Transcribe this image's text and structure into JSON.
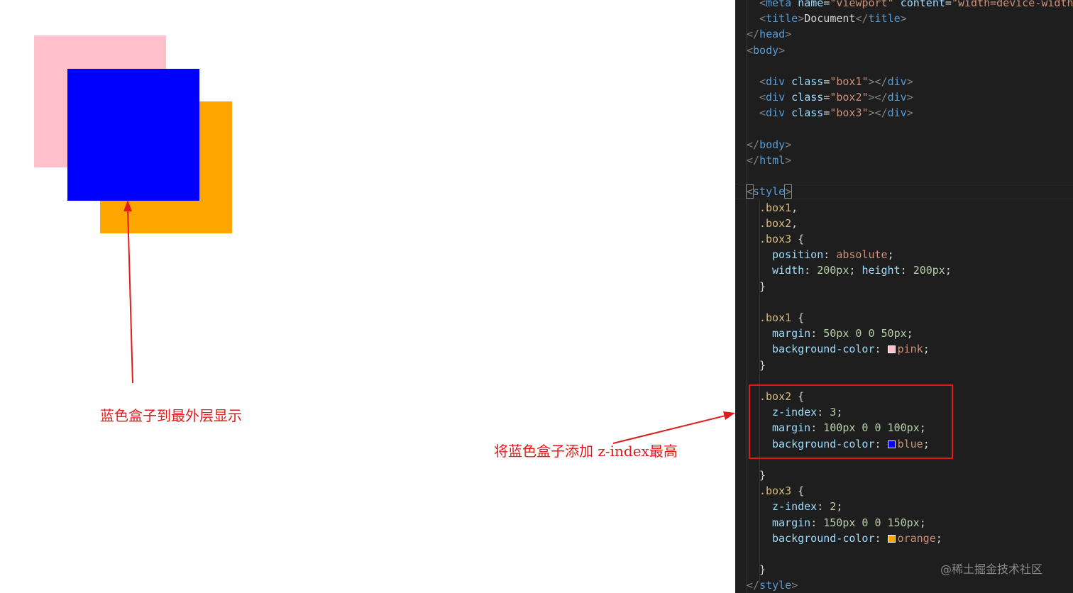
{
  "preview": {
    "boxes": [
      {
        "name": "box1",
        "color": "#ffc0cb"
      },
      {
        "name": "box2",
        "color": "#0000ff"
      },
      {
        "name": "box3",
        "color": "#ffa500"
      }
    ]
  },
  "annotations": {
    "left_note": "蓝色盒子到最外层显示",
    "mid_note": "将蓝色盒子添加  z-index最高",
    "color": "#e31a1a"
  },
  "editor": {
    "lines": [
      [
        [
          "tok-punc",
          "<"
        ],
        [
          "tok-tag",
          "meta"
        ],
        [
          "tok-text",
          " "
        ],
        [
          "tok-attr",
          "name"
        ],
        [
          "tok-text",
          "="
        ],
        [
          "tok-str",
          "\"viewport\""
        ],
        [
          "tok-text",
          " "
        ],
        [
          "tok-attr",
          "content"
        ],
        [
          "tok-text",
          "="
        ],
        [
          "tok-str",
          "\"width=device-width"
        ]
      ],
      [
        [
          "tok-punc",
          "<"
        ],
        [
          "tok-tag",
          "title"
        ],
        [
          "tok-punc",
          ">"
        ],
        [
          "tok-text",
          "Document"
        ],
        [
          "tok-punc",
          "</"
        ],
        [
          "tok-tag",
          "title"
        ],
        [
          "tok-punc",
          ">"
        ]
      ],
      [
        [
          "tok-punc",
          "</"
        ],
        [
          "tok-tag",
          "head"
        ],
        [
          "tok-punc",
          ">"
        ]
      ],
      [
        [
          "tok-punc",
          "<"
        ],
        [
          "tok-tag",
          "body"
        ],
        [
          "tok-punc",
          ">"
        ]
      ],
      [],
      [
        [
          "tok-punc",
          "<"
        ],
        [
          "tok-tag",
          "div"
        ],
        [
          "tok-text",
          " "
        ],
        [
          "tok-attr",
          "class"
        ],
        [
          "tok-text",
          "="
        ],
        [
          "tok-str",
          "\"box1\""
        ],
        [
          "tok-punc",
          "></"
        ],
        [
          "tok-tag",
          "div"
        ],
        [
          "tok-punc",
          ">"
        ]
      ],
      [
        [
          "tok-punc",
          "<"
        ],
        [
          "tok-tag",
          "div"
        ],
        [
          "tok-text",
          " "
        ],
        [
          "tok-attr",
          "class"
        ],
        [
          "tok-text",
          "="
        ],
        [
          "tok-str",
          "\"box2\""
        ],
        [
          "tok-punc",
          "></"
        ],
        [
          "tok-tag",
          "div"
        ],
        [
          "tok-punc",
          ">"
        ]
      ],
      [
        [
          "tok-punc",
          "<"
        ],
        [
          "tok-tag",
          "div"
        ],
        [
          "tok-text",
          " "
        ],
        [
          "tok-attr",
          "class"
        ],
        [
          "tok-text",
          "="
        ],
        [
          "tok-str",
          "\"box3\""
        ],
        [
          "tok-punc",
          "></"
        ],
        [
          "tok-tag",
          "div"
        ],
        [
          "tok-punc",
          ">"
        ]
      ],
      [],
      [
        [
          "tok-punc",
          "</"
        ],
        [
          "tok-tag",
          "body"
        ],
        [
          "tok-punc",
          ">"
        ]
      ],
      [
        [
          "tok-punc",
          "</"
        ],
        [
          "tok-tag",
          "html"
        ],
        [
          "tok-punc",
          ">"
        ]
      ],
      [],
      [
        [
          "tok-punc bracket-box",
          "<"
        ],
        [
          "tok-tag",
          "style"
        ],
        [
          "tok-punc bracket-box",
          ">"
        ]
      ],
      [
        [
          "tok-sel",
          ".box1"
        ],
        [
          "tok-text",
          ","
        ]
      ],
      [
        [
          "tok-sel",
          ".box2"
        ],
        [
          "tok-text",
          ","
        ]
      ],
      [
        [
          "tok-sel",
          ".box3"
        ],
        [
          "tok-text",
          " {"
        ]
      ],
      [
        [
          "tok-prop",
          "position"
        ],
        [
          "tok-text",
          ": "
        ],
        [
          "tok-val",
          "absolute"
        ],
        [
          "tok-text",
          ";"
        ]
      ],
      [
        [
          "tok-prop",
          "width"
        ],
        [
          "tok-text",
          ": "
        ],
        [
          "tok-num",
          "200px"
        ],
        [
          "tok-text",
          "; "
        ],
        [
          "tok-prop",
          "height"
        ],
        [
          "tok-text",
          ": "
        ],
        [
          "tok-num",
          "200px"
        ],
        [
          "tok-text",
          ";"
        ]
      ],
      [
        [
          "tok-text",
          "}"
        ]
      ],
      [],
      [
        [
          "tok-sel",
          ".box1"
        ],
        [
          "tok-text",
          " {"
        ]
      ],
      [
        [
          "tok-prop",
          "margin"
        ],
        [
          "tok-text",
          ": "
        ],
        [
          "tok-num",
          "50px 0 0 50px"
        ],
        [
          "tok-text",
          ";"
        ]
      ],
      [
        [
          "tok-prop",
          "background-color"
        ],
        [
          "tok-text",
          ": "
        ],
        [
          "swatch",
          "#ffc0cb"
        ],
        [
          "tok-val",
          "pink"
        ],
        [
          "tok-text",
          ";"
        ]
      ],
      [
        [
          "tok-text",
          "}"
        ]
      ],
      [],
      [
        [
          "tok-sel",
          ".box2"
        ],
        [
          "tok-text",
          " {"
        ]
      ],
      [
        [
          "tok-prop",
          "z-index"
        ],
        [
          "tok-text",
          ": "
        ],
        [
          "tok-num",
          "3"
        ],
        [
          "tok-text",
          ";"
        ]
      ],
      [
        [
          "tok-prop",
          "margin"
        ],
        [
          "tok-text",
          ": "
        ],
        [
          "tok-num",
          "100px 0 0 100px"
        ],
        [
          "tok-text",
          ";"
        ]
      ],
      [
        [
          "tok-prop",
          "background-color"
        ],
        [
          "tok-text",
          ": "
        ],
        [
          "swatch",
          "#0000ff"
        ],
        [
          "tok-val",
          "blue"
        ],
        [
          "tok-text",
          ";"
        ]
      ],
      [],
      [
        [
          "tok-text",
          "}"
        ]
      ],
      [
        [
          "tok-sel",
          ".box3"
        ],
        [
          "tok-text",
          " {"
        ]
      ],
      [
        [
          "tok-prop",
          "z-index"
        ],
        [
          "tok-text",
          ": "
        ],
        [
          "tok-num",
          "2"
        ],
        [
          "tok-text",
          ";"
        ]
      ],
      [
        [
          "tok-prop",
          "margin"
        ],
        [
          "tok-text",
          ": "
        ],
        [
          "tok-num",
          "150px 0 0 150px"
        ],
        [
          "tok-text",
          ";"
        ]
      ],
      [
        [
          "tok-prop",
          "background-color"
        ],
        [
          "tok-text",
          ": "
        ],
        [
          "swatch",
          "#ffa500"
        ],
        [
          "tok-val",
          "orange"
        ],
        [
          "tok-text",
          ";"
        ]
      ],
      [],
      [
        [
          "tok-text",
          "}"
        ]
      ],
      [
        [
          "tok-punc",
          "</"
        ],
        [
          "tok-tag",
          "style"
        ],
        [
          "tok-punc",
          ">"
        ]
      ]
    ]
  },
  "watermark": "@稀土掘金技术社区"
}
